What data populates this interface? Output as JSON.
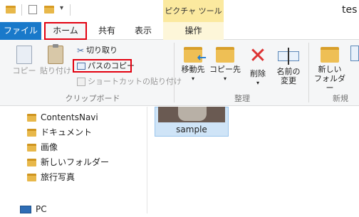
{
  "window": {
    "title": "tes"
  },
  "context_tab": {
    "header": "ピクチャ ツール"
  },
  "tabs": [
    {
      "label": "ファイル"
    },
    {
      "label": "ホーム"
    },
    {
      "label": "共有"
    },
    {
      "label": "表示"
    },
    {
      "label": "操作"
    }
  ],
  "ribbon": {
    "clipboard": {
      "group_label": "クリップボード",
      "copy": "コピー",
      "paste": "貼り付け",
      "cut": "切り取り",
      "copy_path": "パスのコピー",
      "paste_shortcut": "ショートカットの貼り付け"
    },
    "organize": {
      "group_label": "整理",
      "move_to": "移動先",
      "copy_to": "コピー先",
      "delete": "削除",
      "rename_line1": "名前の",
      "rename_line2": "変更"
    },
    "new": {
      "group_label": "新規",
      "new_folder_line1": "新しい",
      "new_folder_line2": "フォルダー"
    }
  },
  "nav": {
    "items": [
      {
        "label": "ContentsNavi"
      },
      {
        "label": "ドキュメント"
      },
      {
        "label": "画像"
      },
      {
        "label": "新しいフォルダー"
      },
      {
        "label": "旅行写真"
      }
    ],
    "pc": "PC"
  },
  "content": {
    "tiles": [
      {
        "label": "sample"
      }
    ]
  },
  "colors": {
    "file_tab": "#1979ca",
    "highlight": "#e2000f",
    "context_tab": "#fbe99f"
  }
}
